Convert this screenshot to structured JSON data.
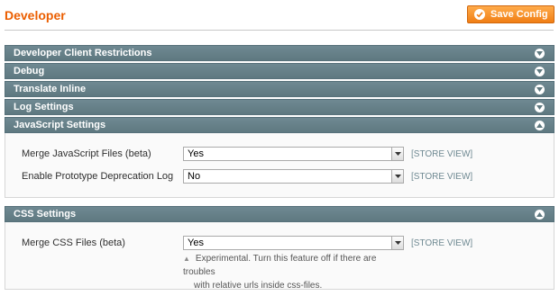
{
  "page": {
    "title": "Developer",
    "save_button": "Save Config"
  },
  "sections": [
    {
      "title": "Developer Client Restrictions",
      "state": "collapsed"
    },
    {
      "title": "Debug",
      "state": "collapsed"
    },
    {
      "title": "Translate Inline",
      "state": "collapsed"
    },
    {
      "title": "Log Settings",
      "state": "collapsed"
    },
    {
      "title": "JavaScript Settings",
      "state": "expanded"
    },
    {
      "title": "CSS Settings",
      "state": "expanded"
    }
  ],
  "js_settings": {
    "merge_js": {
      "label": "Merge JavaScript Files (beta)",
      "value": "Yes",
      "scope": "[STORE VIEW]"
    },
    "deprecation_log": {
      "label": "Enable Prototype Deprecation Log",
      "value": "No",
      "scope": "[STORE VIEW]"
    }
  },
  "css_settings": {
    "merge_css": {
      "label": "Merge CSS Files (beta)",
      "value": "Yes",
      "scope": "[STORE VIEW]",
      "note_line1": "Experimental. Turn this feature off if there are troubles",
      "note_line2": "with relative urls inside css-files."
    }
  },
  "colors": {
    "title": "#eb5e00",
    "button": "#f07e14",
    "section_header": "#6f8992",
    "scope": "#6f8992"
  },
  "icons": {
    "save": "check-circle-icon",
    "collapsed": "chevron-down-icon",
    "expanded": "chevron-up-icon",
    "select": "dropdown-arrow-icon",
    "note": "note-triangle-icon"
  }
}
